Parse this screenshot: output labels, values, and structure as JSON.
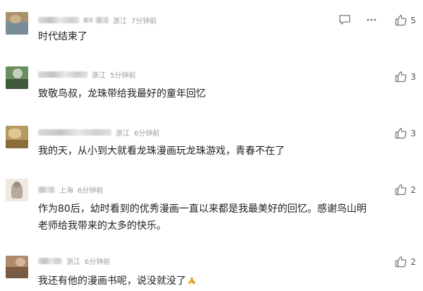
{
  "comments": [
    {
      "location": "浙江",
      "time": "7分钟前",
      "text": "时代结束了",
      "likes": "5",
      "show_tools": true,
      "avatar_colors": [
        "#a8916a",
        "#7b8c99",
        "#c9b48a",
        "#6d5a44"
      ]
    },
    {
      "location": "浙江",
      "time": "5分钟前",
      "text": "致敬鸟叔，龙珠带给我最好的童年回忆",
      "likes": "3",
      "show_tools": false,
      "avatar_colors": [
        "#6a8f5e",
        "#3e5a3a",
        "#9bb38a",
        "#c7d0c0"
      ]
    },
    {
      "location": "浙江",
      "time": "6分钟前",
      "text": "我的天，从小到大就看龙珠漫画玩龙珠游戏，青春不在了",
      "likes": "3",
      "show_tools": false,
      "avatar_colors": [
        "#b59a62",
        "#8a6d3b",
        "#e0c890",
        "#5b4b30"
      ]
    },
    {
      "location": "上海",
      "time": "6分钟前",
      "text_lines": [
        "作为80后，幼时看到的优秀漫画一直以来都是我最美好的回忆。感谢鸟山明",
        "老师给我带来的太多的快乐。"
      ],
      "likes": "2",
      "show_tools": false,
      "avatar_colors": [
        "#d8d0c8",
        "#b9a99a",
        "#efe9e2",
        "#9c8f84"
      ]
    },
    {
      "location": "浙江",
      "time": "6分钟前",
      "text": "我还有他的漫画书呢，说没就没了",
      "emoji_name": "folded-hands-emoji",
      "likes": "2",
      "show_tools": false,
      "avatar_colors": [
        "#b08a6a",
        "#7a5c44",
        "#d7b79b",
        "#5a4434"
      ]
    }
  ],
  "icons": {
    "reply": "comment-bubble-icon",
    "more": "more-dots-icon",
    "like": "thumbs-up-icon"
  }
}
